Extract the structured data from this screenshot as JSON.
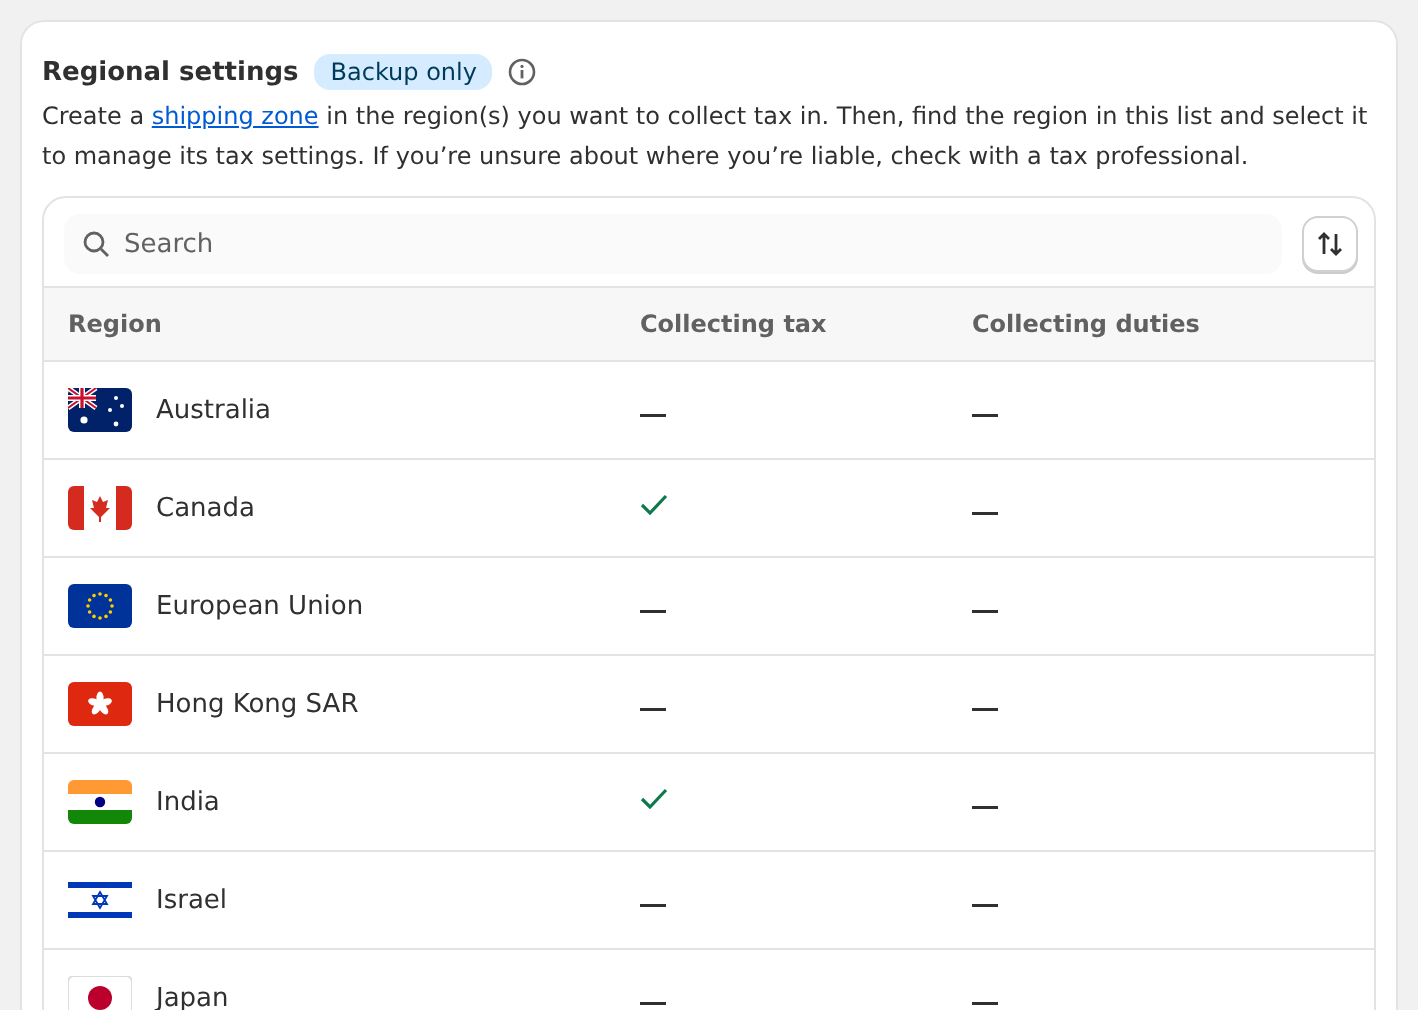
{
  "section": {
    "title": "Regional settings",
    "badge": "Backup only",
    "description_parts": [
      {
        "kind": "text",
        "text": "Create a "
      },
      {
        "kind": "link",
        "text": "shipping zone"
      },
      {
        "kind": "text",
        "text": " in the region(s) you want to collect tax in. Then, find the region in this list and select it to manage its tax settings. If you’re unsure about where you’re liable, check with a tax professional."
      }
    ]
  },
  "search": {
    "placeholder": "Search"
  },
  "table": {
    "columns": [
      "Region",
      "Collecting tax",
      "Collecting duties"
    ],
    "rows": [
      {
        "kind": "au",
        "region": "Australia",
        "collecting_tax": false,
        "collecting_duties": false
      },
      {
        "kind": "ca",
        "region": "Canada",
        "collecting_tax": true,
        "collecting_duties": false
      },
      {
        "kind": "eu",
        "region": "European Union",
        "collecting_tax": false,
        "collecting_duties": false
      },
      {
        "kind": "hk",
        "region": "Hong Kong SAR",
        "collecting_tax": false,
        "collecting_duties": false
      },
      {
        "kind": "in",
        "region": "India",
        "collecting_tax": true,
        "collecting_duties": false
      },
      {
        "kind": "il",
        "region": "Israel",
        "collecting_tax": false,
        "collecting_duties": false
      },
      {
        "kind": "jp",
        "region": "Japan",
        "collecting_tax": false,
        "collecting_duties": false
      }
    ]
  }
}
